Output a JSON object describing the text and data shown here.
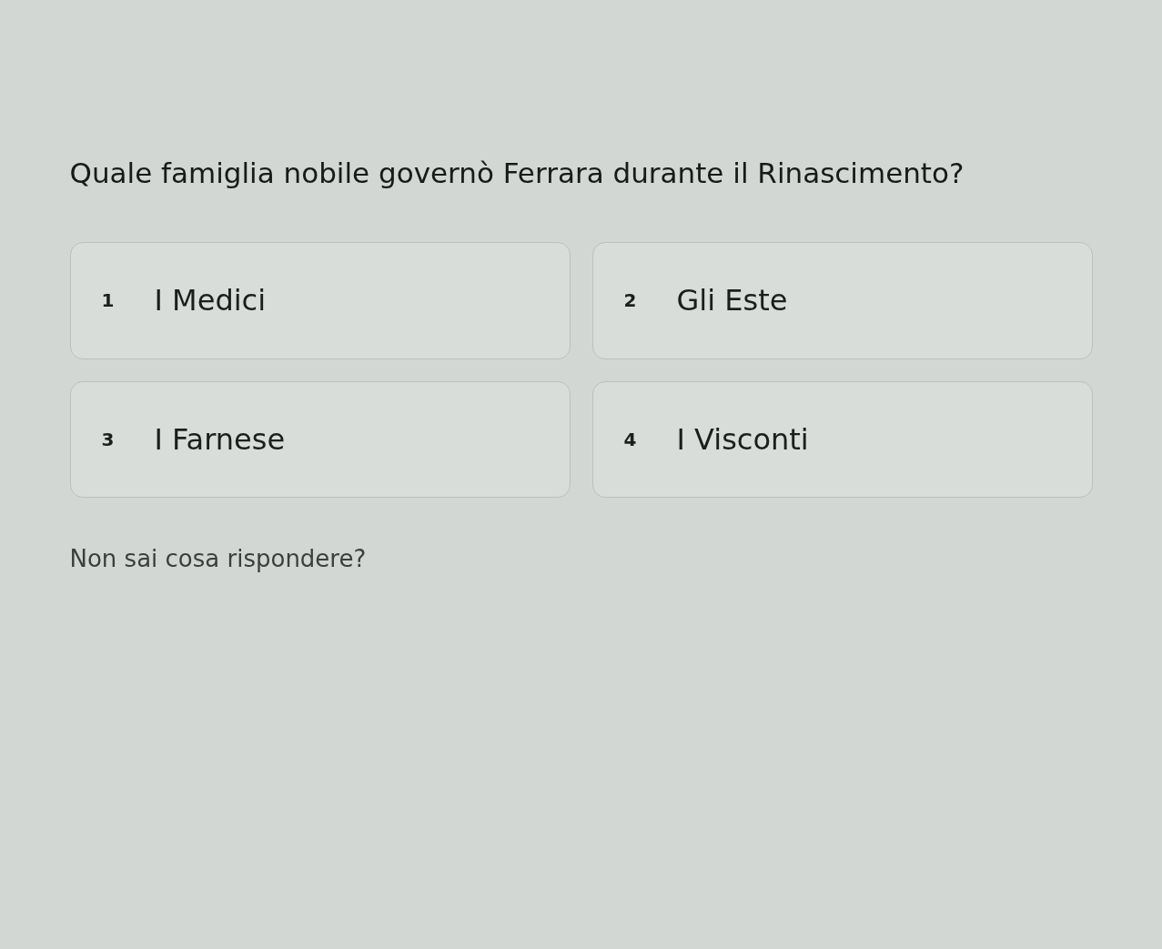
{
  "question": "Quale famiglia nobile governò Ferrara durante il Rinascimento?",
  "options": [
    {
      "number": "1",
      "label": "I Medici",
      "selected": false
    },
    {
      "number": "2",
      "label": "Gli Este",
      "selected": false
    },
    {
      "number": "3",
      "label": "I Farnese",
      "selected": false
    },
    {
      "number": "4",
      "label": "I Visconti",
      "selected": false
    }
  ],
  "help_link": "Non sai cosa rispondere?"
}
